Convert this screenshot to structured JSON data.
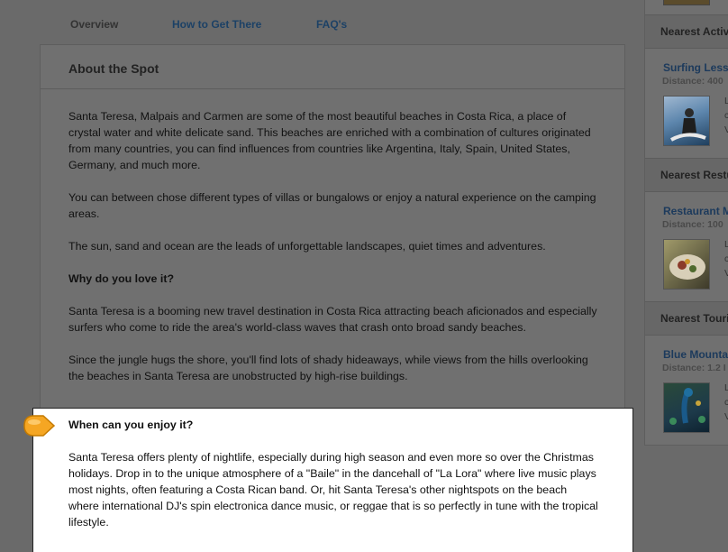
{
  "tabs": [
    {
      "label": "Overview"
    },
    {
      "label": "How to Get There"
    },
    {
      "label": "FAQ's"
    }
  ],
  "section": {
    "title": "About the Spot",
    "paragraphs": [
      "Santa Teresa, Malpais and Carmen are some of the most beautiful beaches in Costa Rica, a place of crystal water and white delicate sand. This beaches are enriched with a combination of cultures originated from many countries, you can find influences from countries like Argentina, Italy, Spain, United States, Germany, and much more.",
      "You can between chose different types of villas or bungalows or enjoy a natural experience on the camping areas.",
      "The sun, sand and ocean are the leads of unforgettable landscapes, quiet times and adventures."
    ],
    "why_heading": "Why do you love it?",
    "why_paragraphs": [
      "Santa Teresa is a booming new travel destination in Costa Rica attracting beach aficionados and especially surfers who come to ride the area's world-class waves that crash onto broad sandy beaches.",
      "Since the jungle hugs the shore, you'll find lots of shady hideaways, while views from the hills overlooking the beaches in Santa Teresa are unobstructed by high-rise buildings."
    ],
    "when_heading": "When can you enjoy it?",
    "when_paragraph": "Santa Teresa offers plenty of nightlife, especially during high season and even more so over the Christmas holidays. Drop in to the unique atmosphere of a \"Baile\" in the dancehall of \"La Lora\" where live music plays most nights, often featuring a Costa Rican band. Or, hit Santa Teresa's other nightspots on the beach where international DJ's spin electronica dance music, or reggae that is so perfectly in tune with the tropical lifestyle."
  },
  "sidebar": {
    "groups": [
      {
        "heading": "Nearest Activ",
        "item_title": "Surfing Less",
        "distance": "Distance: 400",
        "text": "L\nc\nV",
        "icon": "surfer-photo"
      },
      {
        "heading": "Nearest Restu",
        "item_title": "Restaurant M",
        "distance": "Distance: 100",
        "text": "L\nc\nV",
        "icon": "food-photo"
      },
      {
        "heading": "Nearest Touri",
        "item_title": "Blue Mountai",
        "distance": "Distance: 1.2 I",
        "text": "L\nc\nV",
        "icon": "peacock-photo"
      }
    ]
  },
  "colors": {
    "link": "#1c4166",
    "highlight_bg": "#ffffff",
    "pointer": "#f5a623",
    "overlay_bg": "#707070"
  }
}
